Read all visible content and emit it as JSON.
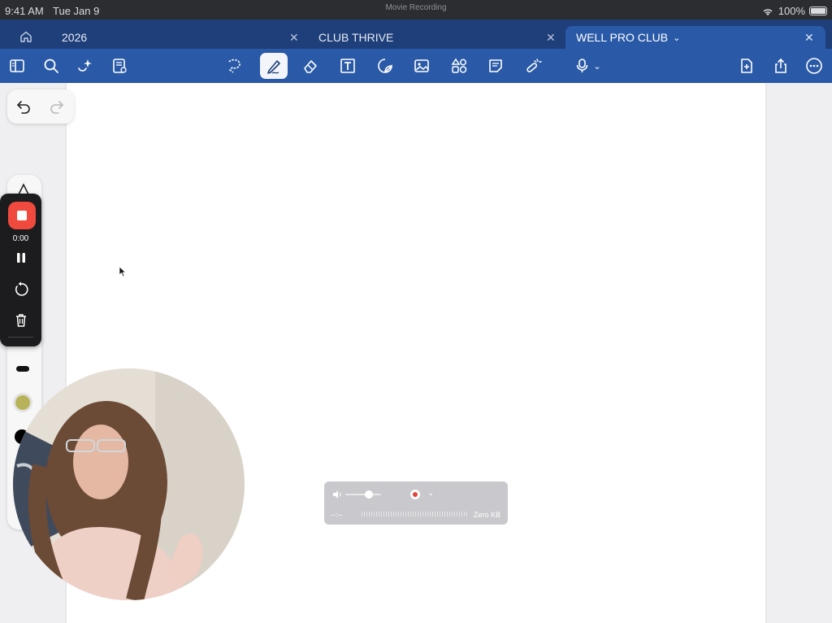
{
  "status_bar": {
    "time": "9:41 AM",
    "date": "Tue Jan 9",
    "recording_title": "Movie Recording",
    "battery": "100%"
  },
  "tabs": [
    {
      "label": "2026"
    },
    {
      "label": "CLUB THRIVE"
    },
    {
      "label": "WELL PRO CLUB",
      "active": true
    }
  ],
  "toolbar": {
    "left_icons": [
      "sidebar-icon",
      "search-icon",
      "ai-sparkle-icon",
      "document-list-icon"
    ],
    "center_icons": [
      "lasso-icon",
      "pen-icon",
      "eraser-icon",
      "textbox-icon",
      "sticker-icon",
      "image-icon",
      "shapes-icon",
      "sticky-note-icon",
      "laser-pointer-icon",
      "microphone-icon"
    ],
    "right_icons": [
      "add-page-icon",
      "share-icon",
      "more-icon"
    ],
    "active_tool": "pen-icon"
  },
  "recording_controls": {
    "elapsed": "0:00",
    "stop_color": "#f04a3e"
  },
  "quicktime_panel": {
    "time_placeholder": "--:--",
    "file_size": "Zero KB"
  },
  "colors": {
    "tab_bar": "#1e3f7a",
    "toolbar": "#2a5aa7",
    "pen_color_selected": "#b8b35a"
  }
}
